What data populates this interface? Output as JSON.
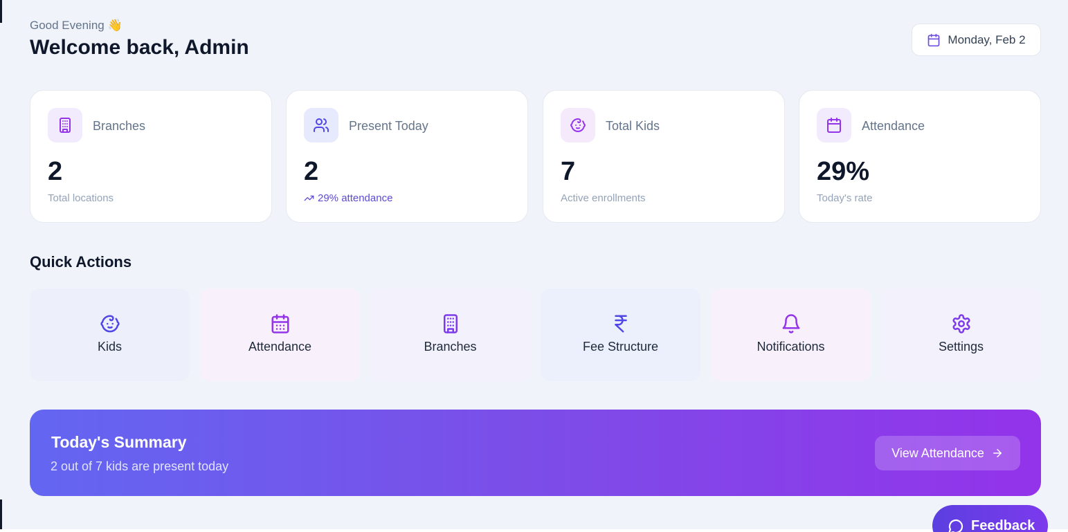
{
  "header": {
    "greeting": "Good Evening 👋",
    "welcome": "Welcome back, Admin",
    "date": "Monday, Feb 2"
  },
  "stats": [
    {
      "label": "Branches",
      "value": "2",
      "sub": "Total locations",
      "icon": "building-icon"
    },
    {
      "label": "Present Today",
      "value": "2",
      "sub": "29% attendance",
      "icon": "users-icon"
    },
    {
      "label": "Total Kids",
      "value": "7",
      "sub": "Active enrollments",
      "icon": "baby-icon"
    },
    {
      "label": "Attendance",
      "value": "29%",
      "sub": "Today's rate",
      "icon": "calendar-icon"
    }
  ],
  "quick_actions": {
    "title": "Quick Actions",
    "items": [
      {
        "label": "Kids",
        "icon": "baby-icon"
      },
      {
        "label": "Attendance",
        "icon": "calendar-icon"
      },
      {
        "label": "Branches",
        "icon": "building-icon"
      },
      {
        "label": "Fee Structure",
        "icon": "rupee-icon"
      },
      {
        "label": "Notifications",
        "icon": "bell-icon"
      },
      {
        "label": "Settings",
        "icon": "gear-icon"
      }
    ]
  },
  "summary": {
    "title": "Today's Summary",
    "subtitle": "2 out of 7 kids are present today",
    "button": "View Attendance"
  },
  "feedback": {
    "label": "Feedback"
  },
  "colors": {
    "accent": "#6366f1",
    "purple": "#9333ea",
    "background": "#f0f3f9"
  }
}
